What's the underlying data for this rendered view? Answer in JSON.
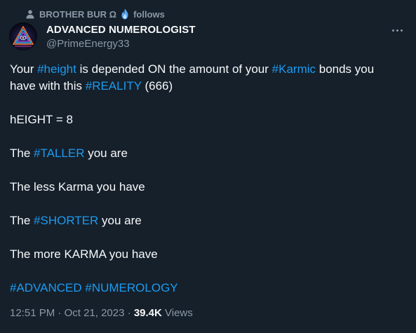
{
  "social_context": {
    "actor": "BROTHER BUR Ω",
    "action": "follows",
    "actor_icon": "person-icon",
    "badge_icon": "blue-flame-emoji-icon"
  },
  "author": {
    "display_name": "ADVANCED NUMEROLOGIST",
    "handle": "@PrimeEnergy33",
    "avatar": "pyramid-eye-avatar"
  },
  "more_icon": "more-horizontal-icon",
  "tweet": {
    "line1_a": "Your ",
    "line1_tag1": "#height",
    "line1_b": " is depended ON the amount of your ",
    "line1_tag2": "#Karmic",
    "line1_c": " bonds you have with this ",
    "line1_tag3": "#REALITY",
    "line1_d": " (666)",
    "line2": "hEIGHT = 8",
    "line3_a": "The ",
    "line3_tag": "#TALLER",
    "line3_b": " you are",
    "line4": "The less Karma you have",
    "line5_a": "The ",
    "line5_tag": "#SHORTER",
    "line5_b": " you are",
    "line6": "The more KARMA you have",
    "line7_tag1": "#ADVANCED",
    "line7_space": " ",
    "line7_tag2": "#NUMEROLOGY"
  },
  "meta": {
    "time": "12:51 PM",
    "sep1": " · ",
    "date": "Oct 21, 2023",
    "sep2": " · ",
    "views_count": "39.4K",
    "views_label": " Views"
  },
  "colors": {
    "background": "#15202b",
    "text_primary": "#f7f9f9",
    "text_secondary": "#8b98a5",
    "link": "#1d9bf0"
  }
}
